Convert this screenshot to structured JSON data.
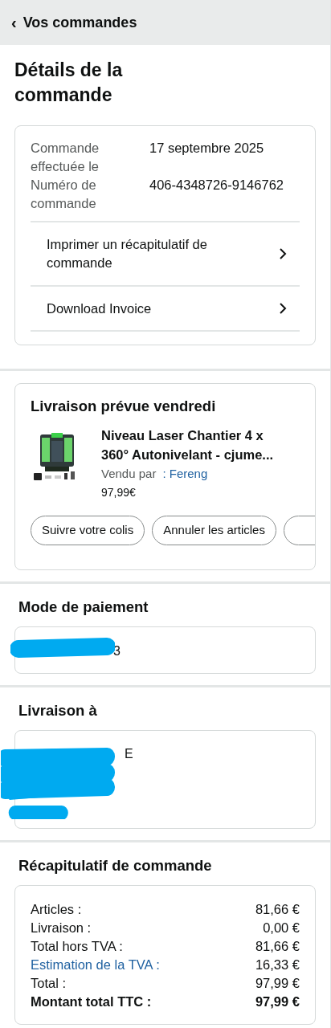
{
  "header": {
    "back_icon": "‹",
    "title": "Vos commandes"
  },
  "page_title": "Détails de la commande",
  "order_info": {
    "fields": [
      {
        "label": "Commande effectuée le",
        "value": "17 septembre 2025"
      },
      {
        "label": "Numéro de commande",
        "value": "406-4348726-9146762"
      }
    ],
    "links": [
      "Imprimer un récapitulatif de commande",
      "Download Invoice"
    ]
  },
  "shipment": {
    "title": "Livraison prévue vendredi",
    "item": {
      "name": "Niveau Laser Chantier 4 x 360° Autonivelant - cjume...",
      "sold_by_label": "Vendu par",
      "seller": ": Fereng",
      "price": "97,99€"
    },
    "buttons": [
      "Suivre votre colis",
      "Annuler les articles"
    ]
  },
  "payment": {
    "title": "Mode de paiement",
    "visible_text": "3"
  },
  "delivery_address": {
    "title": "Livraison à",
    "visible_text": "E"
  },
  "summary": {
    "title": "Récapitulatif de commande",
    "rows": [
      {
        "label": "Articles :",
        "value": "81,66 €",
        "kind": "plain"
      },
      {
        "label": "Livraison :",
        "value": "0,00 €",
        "kind": "plain"
      },
      {
        "label": "Total hors TVA :",
        "value": "81,66 €",
        "kind": "plain"
      },
      {
        "label": "Estimation de la TVA :",
        "value": "16,33 €",
        "kind": "link"
      },
      {
        "label": "Total :",
        "value": "97,99 €",
        "kind": "plain"
      },
      {
        "label": "Montant total TTC :",
        "value": "97,99 €",
        "kind": "total"
      }
    ]
  }
}
